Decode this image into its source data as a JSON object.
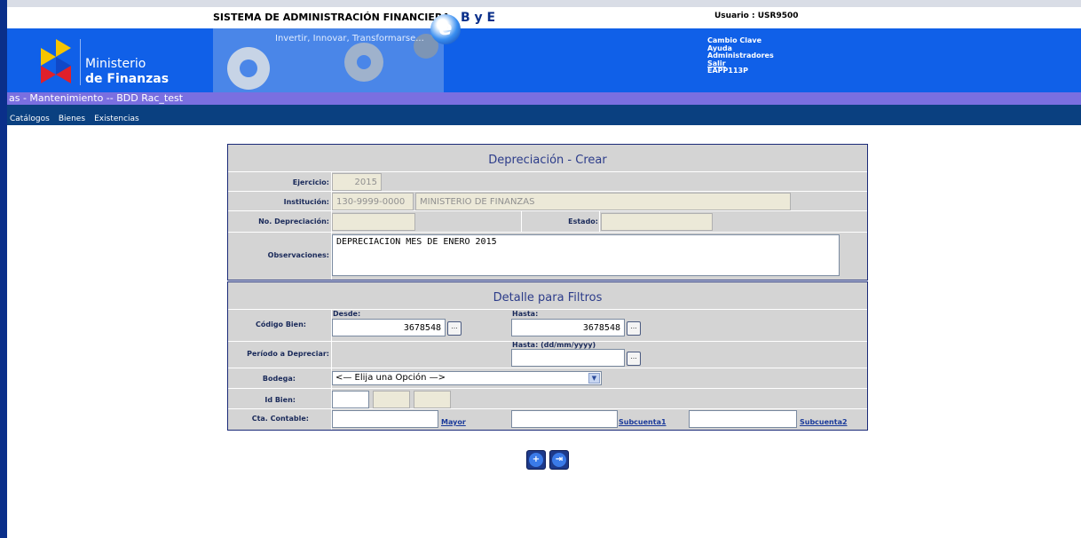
{
  "header": {
    "system_title": "SISTEMA DE ADMINISTRACIÓN FINANCIERA",
    "bye_text": "B y E",
    "slogan": "Invertir, Innovar, Transformarse...",
    "user_label": "Usuario : USR9500",
    "logo_line1": "Ministerio",
    "logo_line2": "de Finanzas",
    "links": {
      "change_password": "Cambio Clave",
      "help": "Ayuda",
      "admins": "Administradores",
      "logout": "Salir",
      "server": "EAPP113P"
    }
  },
  "breadcrumb": "as - Mantenimiento -- BDD Rac_test",
  "menu": [
    "Catálogos",
    "Bienes",
    "Existencias"
  ],
  "form": {
    "title": "Depreciación - Crear",
    "ejercicio_label": "Ejercicio:",
    "ejercicio_value": "2015",
    "institucion_label": "Institución:",
    "institucion_code": "130-9999-0000",
    "institucion_name": "MINISTERIO DE FINANZAS",
    "no_depreciacion_label": "No. Depreciación:",
    "no_depreciacion_value": "",
    "estado_label": "Estado:",
    "estado_value": "",
    "observaciones_label": "Observaciones:",
    "observaciones_value": "DEPRECIACION MES DE ENERO 2015"
  },
  "filters": {
    "title": "Detalle para Filtros",
    "codigo_label": "Código Bien:",
    "desde_label": "Desde:",
    "desde_value": "3678548",
    "hasta_label": "Hasta:",
    "hasta_value": "3678548",
    "periodo_label": "Período a Depreciar:",
    "periodo_hasta_label": "Hasta: (dd/mm/yyyy)",
    "periodo_value": "",
    "bodega_label": "Bodega:",
    "bodega_selected": "<— Elija una Opción —>",
    "id_bien_label": "Id Bien:",
    "cta_contable_label": "Cta. Contable:",
    "mayor_link": "Mayor",
    "subcuenta1_link": "Subcuenta1",
    "subcuenta2_link": "Subcuenta2",
    "dots": "..."
  },
  "colors": {
    "header_blue": "#1060e8",
    "menubar": "#0a4080",
    "breadcrumb": "#7a6fe0",
    "panel_border": "#1a2a78"
  }
}
